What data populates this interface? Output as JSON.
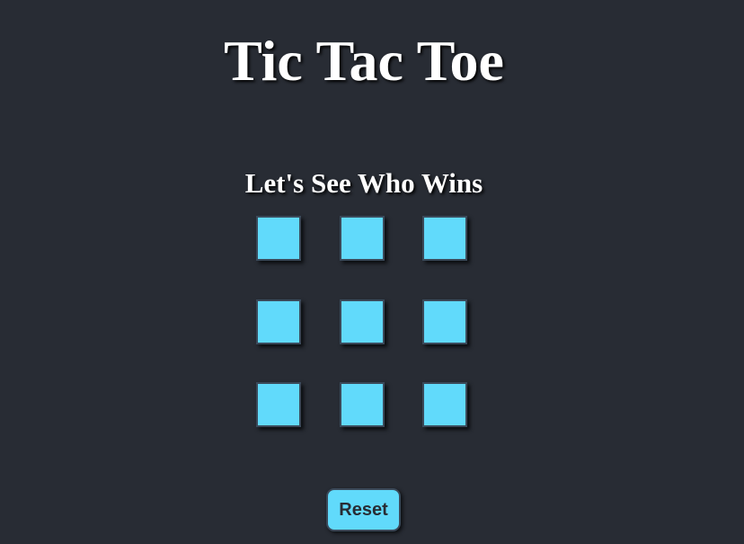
{
  "game": {
    "title": "Tic Tac Toe",
    "subtitle": "Let's See Who Wins",
    "board": {
      "cells": [
        "",
        "",
        "",
        "",
        "",
        "",
        "",
        "",
        ""
      ]
    },
    "reset_label": "Reset"
  },
  "colors": {
    "background": "#282c34",
    "cell": "#61dafb",
    "button": "#61dafb",
    "text": "#ffffff",
    "button_text": "#282c34"
  }
}
